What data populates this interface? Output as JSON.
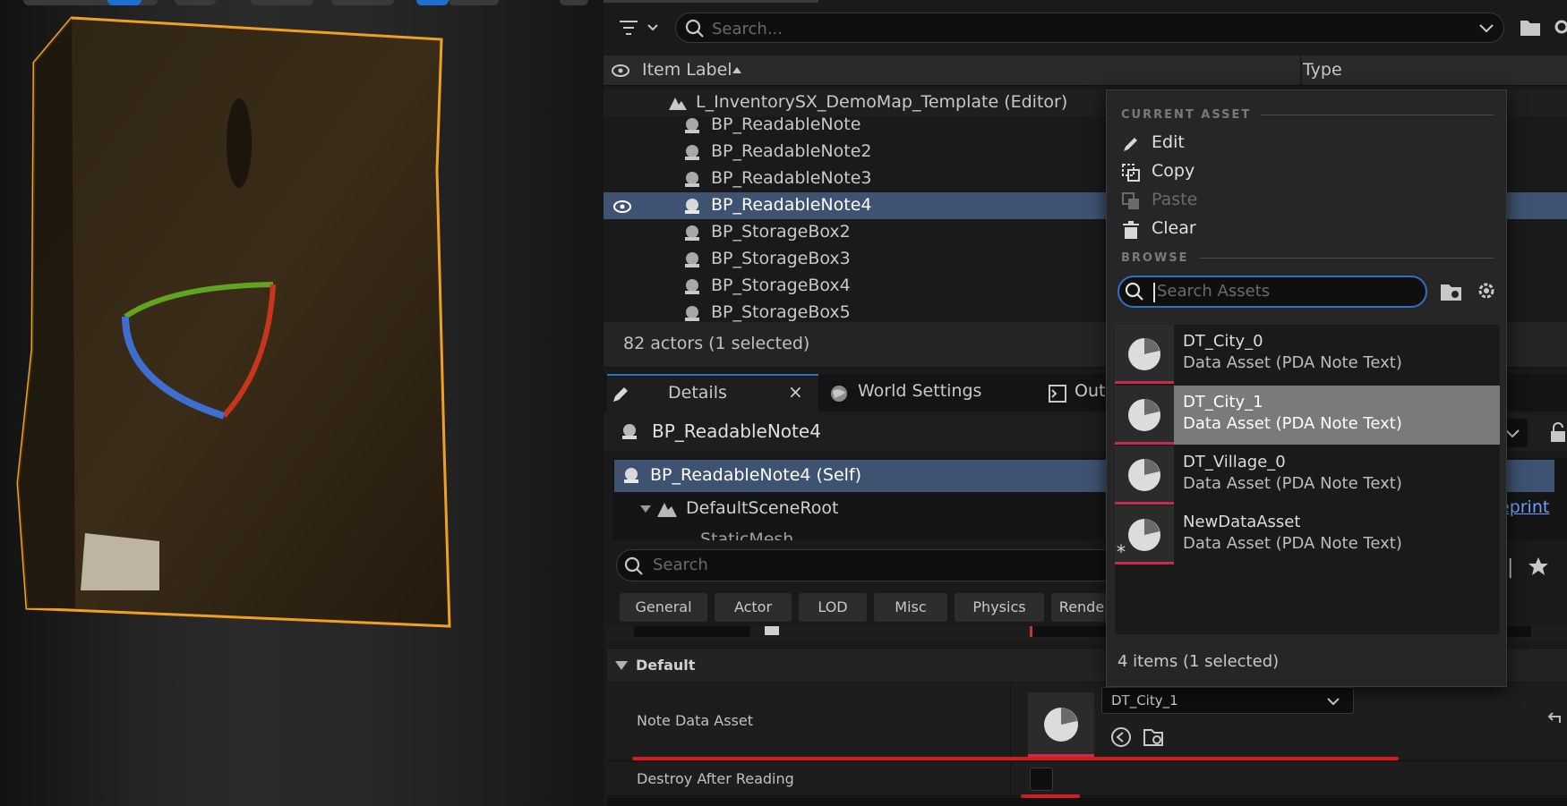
{
  "outliner": {
    "search_placeholder": "Search...",
    "columns": {
      "item_label": "Item Label",
      "type": "Type"
    },
    "items": [
      {
        "label": "L_InventorySX_DemoMap_Template (Editor)",
        "kind": "level"
      },
      {
        "label": "BP_ReadableNote",
        "kind": "actor"
      },
      {
        "label": "BP_ReadableNote2",
        "kind": "actor"
      },
      {
        "label": "BP_ReadableNote3",
        "kind": "actor"
      },
      {
        "label": "BP_ReadableNote4",
        "kind": "actor",
        "selected": true
      },
      {
        "label": "BP_StorageBox2",
        "kind": "actor"
      },
      {
        "label": "BP_StorageBox3",
        "kind": "actor"
      },
      {
        "label": "BP_StorageBox4",
        "kind": "actor"
      },
      {
        "label": "BP_StorageBox5",
        "kind": "actor"
      }
    ],
    "status": "82 actors (1 selected)"
  },
  "details": {
    "tabs": [
      {
        "label": "Details",
        "active": true
      },
      {
        "label": "World Settings"
      },
      {
        "label": "Outp"
      }
    ],
    "actor_name": "BP_ReadableNote4",
    "components": {
      "self": "BP_ReadableNote4 (Self)",
      "root": "DefaultSceneRoot",
      "child": "StaticMesh"
    },
    "link_text": "eprint",
    "search_placeholder": "Search",
    "filters": [
      "General",
      "Actor",
      "LOD",
      "Misc",
      "Physics",
      "Rende"
    ],
    "section": "Default",
    "properties": {
      "note_data_asset": {
        "label": "Note Data Asset",
        "value": "DT_City_1"
      },
      "destroy_after_reading": {
        "label": "Destroy After Reading",
        "checked": false
      }
    }
  },
  "popup": {
    "current_asset_header": "CURRENT ASSET",
    "menu": [
      {
        "label": "Edit",
        "icon": "pencil-icon",
        "enabled": true
      },
      {
        "label": "Copy",
        "icon": "copy-icon",
        "enabled": true
      },
      {
        "label": "Paste",
        "icon": "paste-icon",
        "enabled": false
      },
      {
        "label": "Clear",
        "icon": "trash-icon",
        "enabled": true
      }
    ],
    "browse_header": "BROWSE",
    "search_placeholder": "Search Assets",
    "assets": [
      {
        "name": "DT_City_0",
        "type": "Data Asset (PDA Note Text)"
      },
      {
        "name": "DT_City_1",
        "type": "Data Asset (PDA Note Text)",
        "selected": true
      },
      {
        "name": "DT_Village_0",
        "type": "Data Asset (PDA Note Text)"
      },
      {
        "name": "NewDataAsset",
        "type": "Data Asset (PDA Note Text)",
        "new": true
      }
    ],
    "footer": "4 items (1 selected)"
  },
  "colors": {
    "selection": "#3e5372",
    "accent_blue": "#2b73c8",
    "asset_underline": "#c42b4f",
    "annotation_red": "#d51c1c",
    "gizmo_outline": "#f0a020"
  }
}
